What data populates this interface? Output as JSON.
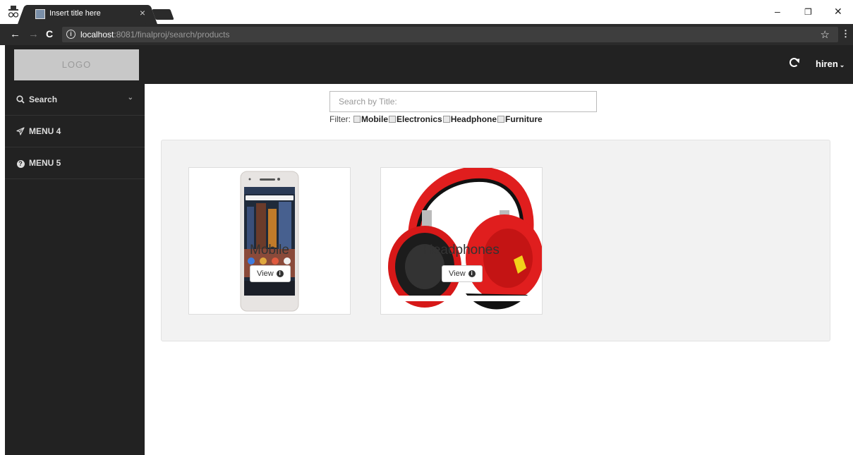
{
  "browser": {
    "tab_title": "Insert title here",
    "tab_close": "×",
    "url_host": "localhost",
    "url_rest": ":8081/finalproj/search/products",
    "window_controls": {
      "minimize": "–",
      "restore": "❐",
      "close": "✕"
    },
    "nav": {
      "back": "←",
      "forward": "→",
      "reload": "C"
    },
    "star": "☆",
    "menu": "⋮"
  },
  "header": {
    "logo": "LOGO",
    "user_name": "hiren",
    "user_chevron": "⌄"
  },
  "sidebar": {
    "items": [
      {
        "label": "Search",
        "icon": "search-icon",
        "glyph": "⚲",
        "has_caret": true,
        "caret": "⌄"
      },
      {
        "label": "MENU 4",
        "icon": "paper-plane-icon",
        "glyph": "✈"
      },
      {
        "label": "MENU 5",
        "icon": "question-circle-icon",
        "glyph": "?"
      }
    ]
  },
  "search": {
    "placeholder": "Search by Title:",
    "filter_label": "Filter:",
    "filters": [
      "Mobile",
      "Electronics",
      "Headphone",
      "Furniture"
    ]
  },
  "products": [
    {
      "label": "Mobile",
      "button": "View",
      "info": "i"
    },
    {
      "label": "Headphones",
      "button": "View",
      "info": "i"
    }
  ],
  "colors": {
    "chrome_dark": "#2b2b2b",
    "app_dark": "#222222",
    "panel_bg": "#f2f2f2",
    "headphone_red": "#e01e1e"
  }
}
